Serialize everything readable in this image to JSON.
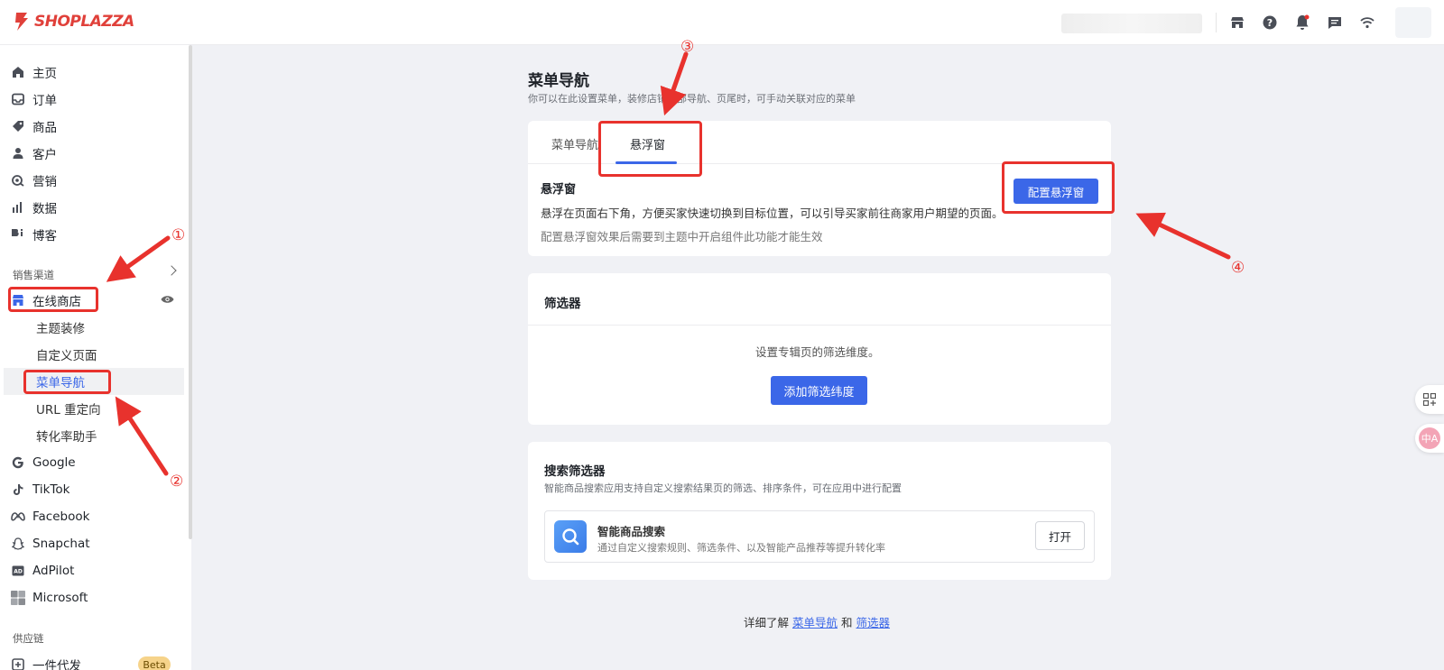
{
  "brand": {
    "name": "SHOPLAZZA",
    "color": "#e0403a"
  },
  "accent": "#3b67e8",
  "annotation_color": "#e8322d",
  "topbar": {
    "icons": [
      "store-icon",
      "help-icon",
      "bell-icon",
      "chat-icon",
      "wifi-icon"
    ]
  },
  "sidebar": {
    "main_items": [
      {
        "label": "主页",
        "icon": "home-icon"
      },
      {
        "label": "订单",
        "icon": "inbox-icon"
      },
      {
        "label": "商品",
        "icon": "tag-icon"
      },
      {
        "label": "客户",
        "icon": "user-icon"
      },
      {
        "label": "营销",
        "icon": "marketing-icon"
      },
      {
        "label": "数据",
        "icon": "chart-icon"
      },
      {
        "label": "博客",
        "icon": "blog-icon"
      }
    ],
    "sales_channel_label": "销售渠道",
    "online_store": {
      "label": "在线商店",
      "icon": "store-icon"
    },
    "online_store_subitems": [
      "主题装修",
      "自定义页面",
      "菜单导航",
      "URL 重定向",
      "转化率助手"
    ],
    "active_subitem": "菜单导航",
    "channels": [
      {
        "label": "Google",
        "icon": "google-icon"
      },
      {
        "label": "TikTok",
        "icon": "tiktok-icon"
      },
      {
        "label": "Facebook",
        "icon": "meta-icon"
      },
      {
        "label": "Snapchat",
        "icon": "snapchat-icon"
      },
      {
        "label": "AdPilot",
        "icon": "ad-icon"
      },
      {
        "label": "Microsoft",
        "icon": "microsoft-icon"
      }
    ],
    "supply_chain_label": "供应链",
    "dropship": {
      "label": "一件代发",
      "badge": "Beta"
    }
  },
  "page": {
    "title": "菜单导航",
    "subtitle": "你可以在此设置菜单，装修店铺顶部导航、页尾时，可手动关联对应的菜单"
  },
  "tabs_card": {
    "tabs": [
      "菜单导航",
      "悬浮窗"
    ],
    "active_tab": "悬浮窗",
    "heading": "悬浮窗",
    "description": "悬浮在页面右下角，方便买家快速切换到目标位置，可以引导买家前往商家用户期望的页面。",
    "note": "配置悬浮窗效果后需要到主题中开启组件此功能才能生效",
    "button": "配置悬浮窗"
  },
  "filter_card": {
    "heading": "筛选器",
    "description": "设置专辑页的筛选维度。",
    "button": "添加筛选纬度"
  },
  "search_filter_card": {
    "heading": "搜索筛选器",
    "subtitle": "智能商品搜索应用支持自定义搜索结果页的筛选、排序条件，可在应用中进行配置",
    "app_name": "智能商品搜索",
    "app_desc": "通过自定义搜索规则、筛选条件、以及智能产品推荐等提升转化率",
    "app_button": "打开"
  },
  "footer": {
    "prefix": "详细了解",
    "link1": "菜单导航",
    "and": "和",
    "link2": "筛选器"
  },
  "annotations": [
    "①",
    "②",
    "③",
    "④"
  ],
  "right_float": {
    "translate_label": "中A"
  }
}
